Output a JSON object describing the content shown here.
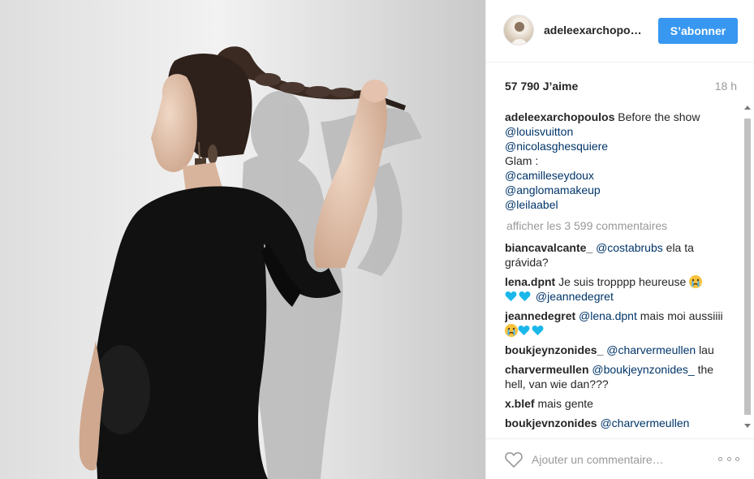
{
  "post": {
    "username": "adeleexarchopo…",
    "follow_label": "S’abonner",
    "likes": "57 790 J’aime",
    "time": "18 h",
    "caption": {
      "user": "adeleexarchopoulos",
      "text": "Before the show",
      "mention_1": "@louisvuitton",
      "mention_2": "@nicolasghesquiere",
      "glam": "Glam :",
      "mention_3": "@camilleseydoux",
      "mention_4": "@anglomamakeup",
      "mention_5": "@leilaabel"
    },
    "load_more": "afficher les 3 599 commentaires",
    "comments": [
      {
        "user": "biancavalcante_",
        "mention": "@costabrubs",
        "text": "ela ta grávida?"
      },
      {
        "user": "lena.dpnt",
        "text": "Je suis tropppp heureuse",
        "mention": "@jeannedegret"
      },
      {
        "user": "jeannedegret",
        "mention": "@lena.dpnt",
        "text": "mais moi aussiiii"
      },
      {
        "user": "boukjeynzonides_",
        "mention": "@charvermeullen",
        "text": "lau"
      },
      {
        "user": "charvermeullen",
        "mention": "@boukjeynzonides_",
        "text": "the hell, van wie dan???"
      },
      {
        "user": "x.blef",
        "text": "mais gente"
      },
      {
        "user": "boukjevnzonides",
        "mention": "@charvermeullen",
        "text": ""
      }
    ],
    "add_comment_placeholder": "Ajouter un commentaire…"
  },
  "icons": {
    "like": "heart-outline-icon",
    "more": "more-options-icon",
    "heart_emoji": "blue-heart-icon",
    "cry_emoji": "crying-face-icon"
  },
  "colors": {
    "accent": "#3897f0",
    "mention": "#003569",
    "muted": "#999999",
    "blue_heart": "#1ab7ea"
  }
}
